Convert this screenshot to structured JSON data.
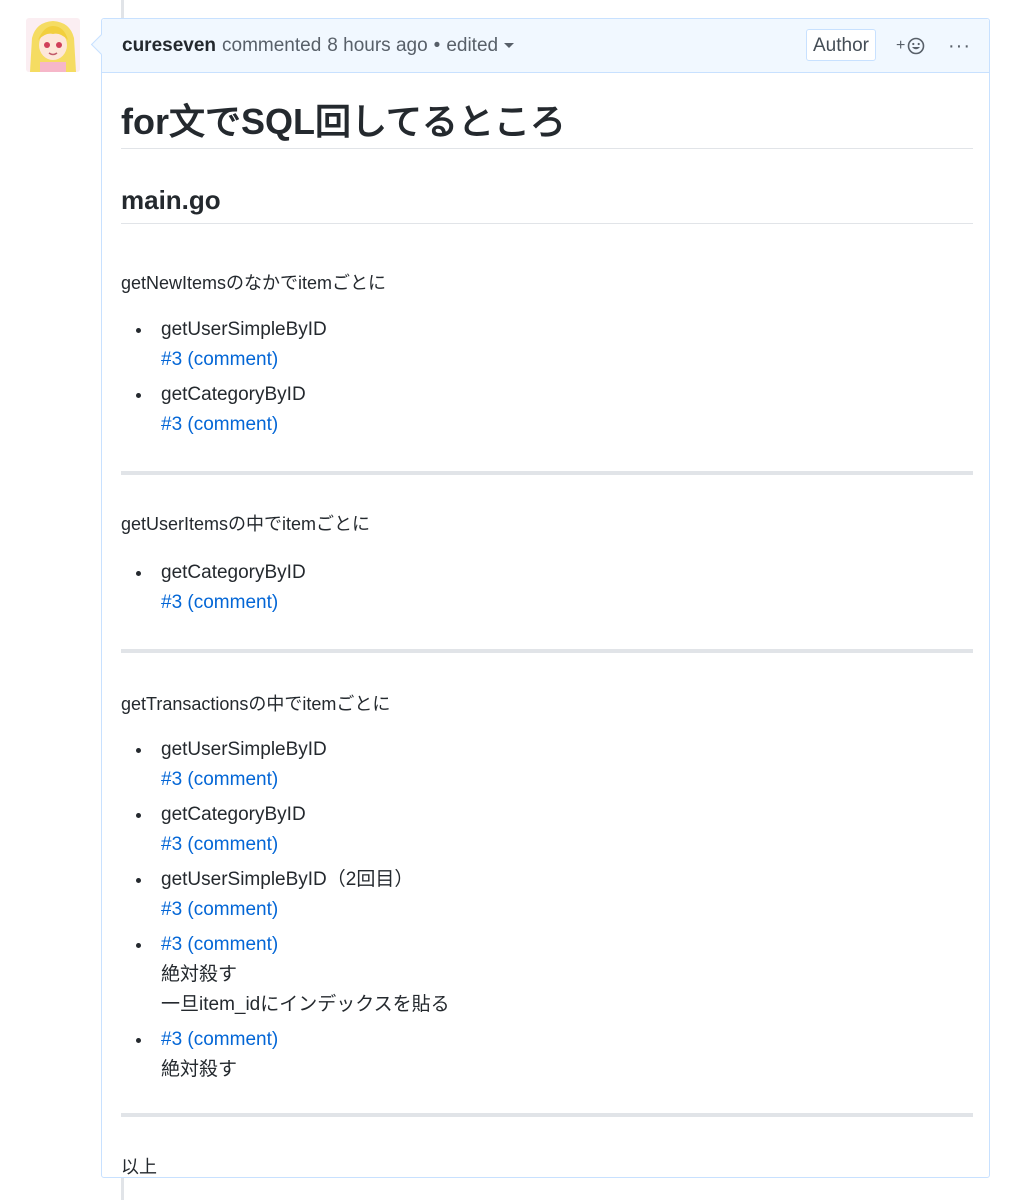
{
  "comment": {
    "author": "cureseven",
    "action": "commented",
    "time": "8 hours ago",
    "separator": "•",
    "edited_label": "edited",
    "badge": "Author",
    "reaction_plus": "+",
    "more": "···"
  },
  "content": {
    "h1": "for文でSQL回してるところ",
    "h2": "main.go",
    "section1": {
      "intro": "getNewItemsのなかでitemごとに",
      "items": [
        {
          "text": "getUserSimpleByID",
          "link": "#3 (comment)"
        },
        {
          "text": "getCategoryByID",
          "link": "#3 (comment)"
        }
      ]
    },
    "section2": {
      "intro": "getUserItemsの中でitemごとに",
      "items": [
        {
          "text": "getCategoryByID",
          "link": "#3 (comment)"
        }
      ]
    },
    "section3": {
      "intro": "getTransactionsの中でitemごとに",
      "items": [
        {
          "text": "getUserSimpleByID",
          "link": "#3 (comment)"
        },
        {
          "text": "getCategoryByID",
          "link": "#3 (comment)"
        },
        {
          "text": "getUserSimpleByID（2回目）",
          "link": "#3 (comment)"
        },
        {
          "link": "#3 (comment)",
          "note1": "絶対殺す",
          "note2": "一旦item_idにインデックスを貼る"
        },
        {
          "link": "#3 (comment)",
          "note1": "絶対殺す"
        }
      ]
    },
    "footer": "以上"
  },
  "colors": {
    "link": "#0366d6",
    "header_bg": "#f1f8ff",
    "border": "#c8e1ff"
  }
}
